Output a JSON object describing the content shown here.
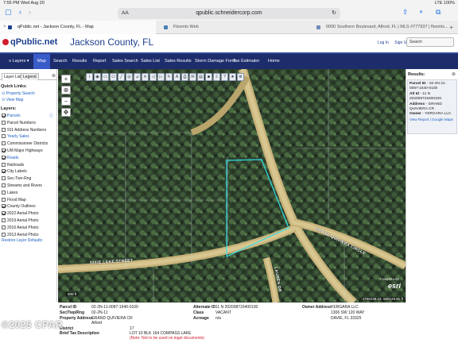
{
  "status": {
    "time_date": "7:55 PM   Wed Aug 20",
    "battery": "LTE  100%"
  },
  "browser": {
    "url": "qpublic.schneidercorp.com",
    "aa_label": "AA",
    "tabs": [
      {
        "title": "qPublic.net - Jackson County, FL - Map",
        "color": "#1c3f8c"
      },
      {
        "title": "Flexmls Web",
        "color": "#4a7fb8"
      },
      {
        "title": "0000 Southern Boulevard, Alford, FL | MLS #777937 | flexmls...",
        "color": "#6b8bb8"
      }
    ]
  },
  "header": {
    "logo": "qPublic.net",
    "county": "Jackson County, FL",
    "login": "Log In",
    "signup": "Sign Up",
    "search_label": "Search"
  },
  "nav": [
    "Layers",
    "Map",
    "Search",
    "Results",
    "Report",
    "Sales Search",
    "Sales List",
    "Sales Results",
    "Storm Damage Form",
    "Tax Estimator",
    "Home"
  ],
  "left": {
    "tab_layer_list": "Layer List",
    "tab_legend": "Legend",
    "quick_links_title": "Quick Links:",
    "quick_links": [
      "Property Search",
      "View Map"
    ],
    "layers_title": "Layers:",
    "layers": [
      {
        "label": "Parcels",
        "checked": true,
        "blue": true
      },
      {
        "label": "Parcel Numbers",
        "checked": false,
        "blue": false
      },
      {
        "label": "911 Address Numbers",
        "checked": false,
        "blue": false
      },
      {
        "label": "Yearly Sales",
        "checked": false,
        "blue": true
      },
      {
        "label": "Commissioner Districts",
        "checked": false,
        "blue": false
      },
      {
        "label": "UM Major Highways",
        "checked": true,
        "blue": false
      },
      {
        "label": "Roads",
        "checked": true,
        "blue": true
      },
      {
        "label": "Railroads",
        "checked": false,
        "blue": false
      },
      {
        "label": "City Labels",
        "checked": true,
        "blue": false
      },
      {
        "label": "Sec-Twn-Rng",
        "checked": false,
        "blue": false
      },
      {
        "label": "Streams and Rivers",
        "checked": false,
        "blue": false
      },
      {
        "label": "Lakes",
        "checked": false,
        "blue": false
      },
      {
        "label": "Flood Map",
        "checked": false,
        "blue": false
      },
      {
        "label": "County Outlines",
        "checked": true,
        "blue": false
      },
      {
        "label": "2022 Aerial Photo",
        "checked": true,
        "blue": false
      },
      {
        "label": "2019 Aerial Photo",
        "checked": false,
        "blue": false
      },
      {
        "label": "2016 Aerial Photo",
        "checked": false,
        "blue": false
      },
      {
        "label": "2013 Aerial Photo",
        "checked": false,
        "blue": false
      }
    ],
    "restore_layers": "Restore Layer Defaults"
  },
  "map": {
    "roads": {
      "lauren_dr": "LAUREN DR",
      "grand_quiviera": "GRAND QUIVIERA CIRCLE",
      "pinehurst": "DIXIE LAKE STREET"
    },
    "scale": "500 ft",
    "coords": "1705238.43, 500128.91 ft",
    "powered_by": "POWERED BY",
    "esri": "esri"
  },
  "results": {
    "title": "Results:",
    "parcel_id_label": "Parcel ID",
    "parcel_id": "02-2N-11-0087-1640-0100",
    "alt_id_label": "Alt Id",
    "alt_id": "11 N 202008716400100",
    "address_label": "Address",
    "address": "GRAND QUIVIERA CR",
    "owner_label": "Owner",
    "owner": "YERGARA LLC",
    "view_report": "View Report",
    "google_maps": "Google Maps"
  },
  "info": {
    "parcel_id_label": "Parcel ID",
    "parcel_id": "02-2N-11-0087-1640-0100",
    "sec_twp_rng_label": "Sec/Twp/Rng",
    "sec_twp_rng": "02-2N-11",
    "property_address_label": "Property Address",
    "property_address_1": "GRAND QUIVIERA CR",
    "property_address_2": "Alford",
    "district_label": "District",
    "district": "17",
    "brief_tax_label": "Brief Tax Description",
    "brief_tax": "LOT 10 BLK 164 COMPASS LAKE",
    "brief_tax_note": "(Note: Not to be used on legal documents)",
    "alt_id_label": "Alternate ID",
    "alt_id": "11 N 202008716400100",
    "class_label": "Class",
    "class": "VACANT",
    "acreage_label": "Acreage",
    "acreage": "n/a",
    "owner_address_label": "Owner Address",
    "owner_1": "YERGARA LLC",
    "owner_2": "1306 SW 120 WAY",
    "owner_3": "DAVIE, FL 33325"
  },
  "watermark": "©2025 CPAR"
}
